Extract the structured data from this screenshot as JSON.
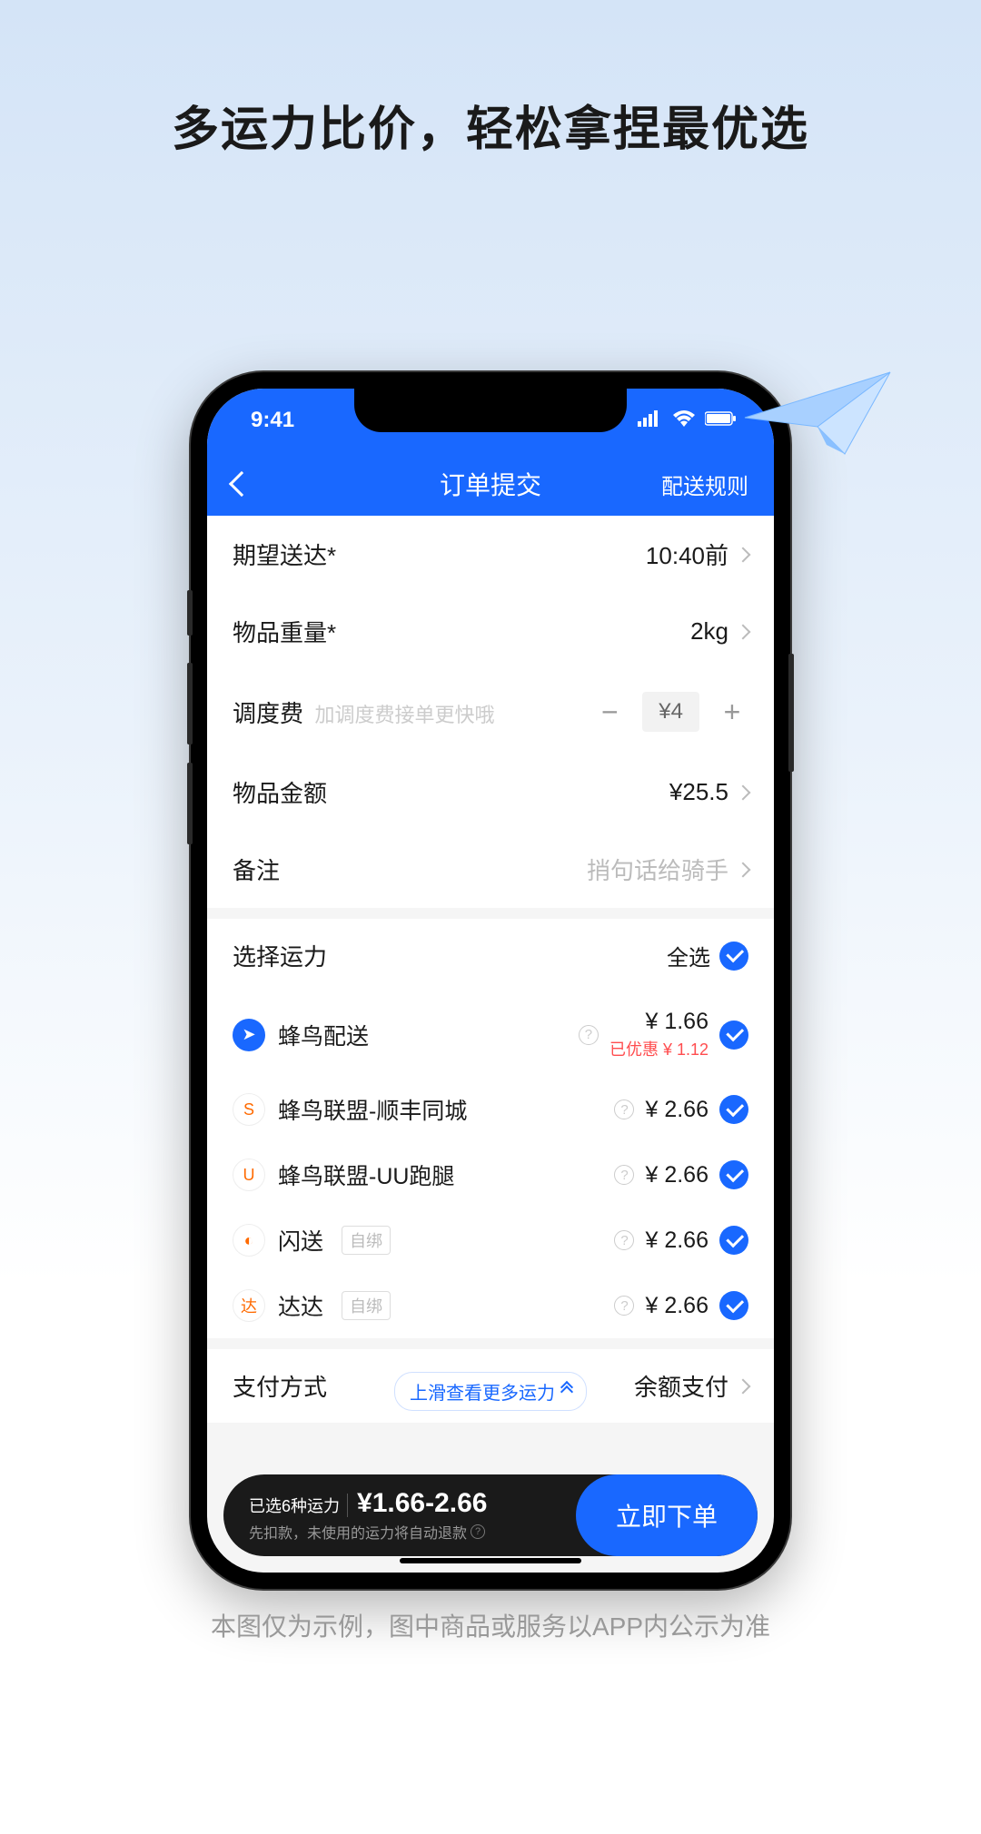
{
  "headline": "多运力比价，轻松拿捏最优选",
  "status": {
    "time": "9:41"
  },
  "nav": {
    "title": "订单提交",
    "action": "配送规则"
  },
  "form": {
    "delivery_label": "期望送达*",
    "delivery_value": "10:40前",
    "weight_label": "物品重量*",
    "weight_value": "2kg",
    "dispatch_label": "调度费",
    "dispatch_hint": "加调度费接单更快哦",
    "dispatch_value": "¥4",
    "amount_label": "物品金额",
    "amount_value": "¥25.5",
    "remark_label": "备注",
    "remark_placeholder": "捎句话给骑手"
  },
  "carriers": {
    "header": "选择运力",
    "select_all": "全选",
    "items": [
      {
        "name": "蜂鸟配送",
        "price": "¥ 1.66",
        "discount": "已优惠 ¥ 1.12",
        "logo_bg": "#1968ff",
        "logo_text": "➤",
        "tag": ""
      },
      {
        "name": "蜂鸟联盟-顺丰同城",
        "price": "¥ 2.66",
        "discount": "",
        "logo_bg": "#fff",
        "logo_text": "S",
        "tag": ""
      },
      {
        "name": "蜂鸟联盟-UU跑腿",
        "price": "¥ 2.66",
        "discount": "",
        "logo_bg": "#fff",
        "logo_text": "U",
        "tag": ""
      },
      {
        "name": "闪送",
        "price": "¥ 2.66",
        "discount": "",
        "logo_bg": "#fff",
        "logo_text": "◐",
        "tag": "自绑"
      },
      {
        "name": "达达",
        "price": "¥ 2.66",
        "discount": "",
        "logo_bg": "#fff",
        "logo_text": "达",
        "tag": "自绑"
      }
    ],
    "swipe_hint": "上滑查看更多运力"
  },
  "payment": {
    "label": "支付方式",
    "value": "余额支付"
  },
  "bottom": {
    "selected_text": "已选6种运力",
    "price_range": "¥1.66-2.66",
    "note": "先扣款，未使用的运力将自动退款",
    "submit": "立即下单"
  },
  "disclaimer": "本图仅为示例，图中商品或服务以APP内公示为准"
}
